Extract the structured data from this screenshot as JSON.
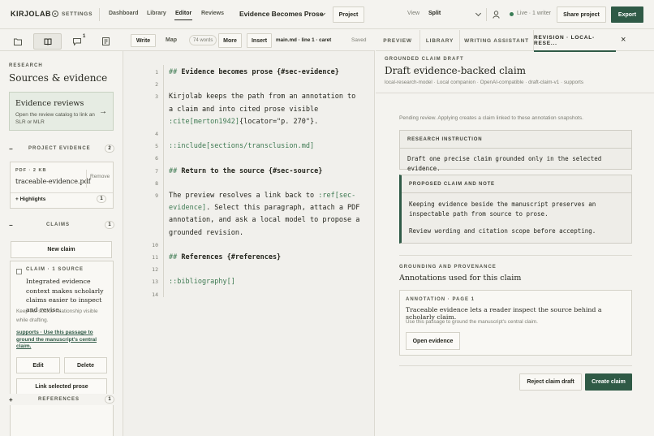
{
  "topbar": {
    "logo": "KIRJOLAB",
    "settings": "SETTINGS",
    "nav": [
      "Dashboard",
      "Library",
      "Editor",
      "Reviews"
    ],
    "doc_title": "Evidence Becomes Prose",
    "project_button": "Project",
    "view_label": "View",
    "view_value": "Split",
    "live_status": "Live · 1 writer",
    "share_button": "Share project",
    "export_button": "Export"
  },
  "left": {
    "comment_count": "1",
    "eyebrow": "RESEARCH",
    "title": "Sources & evidence",
    "reviews_card": {
      "title": "Evidence reviews",
      "desc": "Open the review catalog to link an SLR or MLR",
      "arrow": "→"
    },
    "project_evidence": {
      "toggle": "−",
      "label": "PROJECT EVIDENCE",
      "count": "2"
    },
    "file": {
      "meta": "PDF · 2 KB",
      "name": "traceable-evidence.pdf",
      "remove": "Remove",
      "highlights": "+ Highlights",
      "highlights_count": "1"
    },
    "claims": {
      "toggle": "−",
      "label": "CLAIMS",
      "count": "1"
    },
    "new_claim": "New claim",
    "claim": {
      "meta": "CLAIM · 1 SOURCE",
      "text": "Integrated evidence context makes scholarly claims easier to inspect and revise.",
      "note": "Keep the source relationship visible while drafting.",
      "supports": "supports · Use this passage to ground the manuscript's central claim.",
      "edit": "Edit",
      "delete": "Delete",
      "link": "Link selected prose"
    },
    "references": {
      "toggle": "+",
      "label": "REFERENCES",
      "count": "1"
    }
  },
  "editor": {
    "write_tab": "Write",
    "map_tab": "Map",
    "word_count": "74 words",
    "more": "More",
    "insert": "Insert",
    "file_status": "main.md · line 1 · caret",
    "saved": "Saved",
    "lines": [
      {
        "n": "1",
        "parts": [
          {
            "t": "## ",
            "c": "tok"
          },
          {
            "t": "Evidence becomes prose {#sec-evidence}",
            "c": "hd"
          }
        ]
      },
      {
        "n": "2",
        "parts": []
      },
      {
        "n": "3",
        "parts": [
          {
            "t": "Kirjolab keeps the path from an annotation to",
            "c": ""
          }
        ]
      },
      {
        "n": "",
        "parts": [
          {
            "t": "a claim and into cited prose visible",
            "c": ""
          }
        ]
      },
      {
        "n": "",
        "parts": [
          {
            "t": ":cite[merton1942]",
            "c": "tok"
          },
          {
            "t": "{locator=\"p. 270\"}.",
            "c": ""
          }
        ]
      },
      {
        "n": "4",
        "parts": []
      },
      {
        "n": "5",
        "parts": [
          {
            "t": "::include[sections/transclusion.md]",
            "c": "tok"
          }
        ]
      },
      {
        "n": "6",
        "parts": []
      },
      {
        "n": "7",
        "parts": [
          {
            "t": "## ",
            "c": "tok"
          },
          {
            "t": "Return to the source {#sec-source}",
            "c": "hd"
          }
        ]
      },
      {
        "n": "8",
        "parts": []
      },
      {
        "n": "9",
        "parts": [
          {
            "t": "The preview resolves a link back to ",
            "c": ""
          },
          {
            "t": ":ref[sec-",
            "c": "tok"
          }
        ]
      },
      {
        "n": "",
        "parts": [
          {
            "t": "evidence]",
            "c": "tok"
          },
          {
            "t": ". Select this paragraph, attach a PDF",
            "c": ""
          }
        ]
      },
      {
        "n": "",
        "parts": [
          {
            "t": "annotation, and ask a local model to propose a",
            "c": ""
          }
        ]
      },
      {
        "n": "",
        "parts": [
          {
            "t": "grounded revision.",
            "c": ""
          }
        ]
      },
      {
        "n": "10",
        "parts": []
      },
      {
        "n": "11",
        "parts": [
          {
            "t": "## ",
            "c": "tok"
          },
          {
            "t": "References {#references}",
            "c": "hd"
          }
        ]
      },
      {
        "n": "12",
        "parts": []
      },
      {
        "n": "13",
        "parts": [
          {
            "t": "::bibliography[]",
            "c": "tok"
          }
        ]
      },
      {
        "n": "14",
        "parts": []
      }
    ]
  },
  "right": {
    "tabs": [
      "PREVIEW",
      "LIBRARY",
      "WRITING ASSISTANT",
      "REVISION · LOCAL-RESE..."
    ],
    "close": "×",
    "eyebrow": "GROUNDED CLAIM DRAFT",
    "title": "Draft evidence-backed claim",
    "meta": "local-research-model · Local companion · OpenAI-compatible · draft-claim-v1 · supports",
    "pending": "Pending review. Applying creates a claim linked to these annotation snapshots.",
    "instruction_header": "RESEARCH INSTRUCTION",
    "instruction_body": "Draft one precise claim grounded only in the selected evidence.",
    "proposed_header": "PROPOSED CLAIM AND NOTE",
    "proposed_body": "Keeping evidence beside the manuscript preserves an inspectable path from source to prose.",
    "proposed_note": "Review wording and citation scope before accepting.",
    "grounding_eyebrow": "GROUNDING AND PROVENANCE",
    "grounding_title": "Annotations used for this claim",
    "annotation_meta": "ANNOTATION · PAGE 1",
    "annotation_text": "Traceable evidence lets a reader inspect the source behind a scholarly claim.",
    "annotation_note": "Use this passage to ground the manuscript's central claim.",
    "open_evidence": "Open evidence",
    "reject": "Reject claim draft",
    "create": "Create claim"
  }
}
